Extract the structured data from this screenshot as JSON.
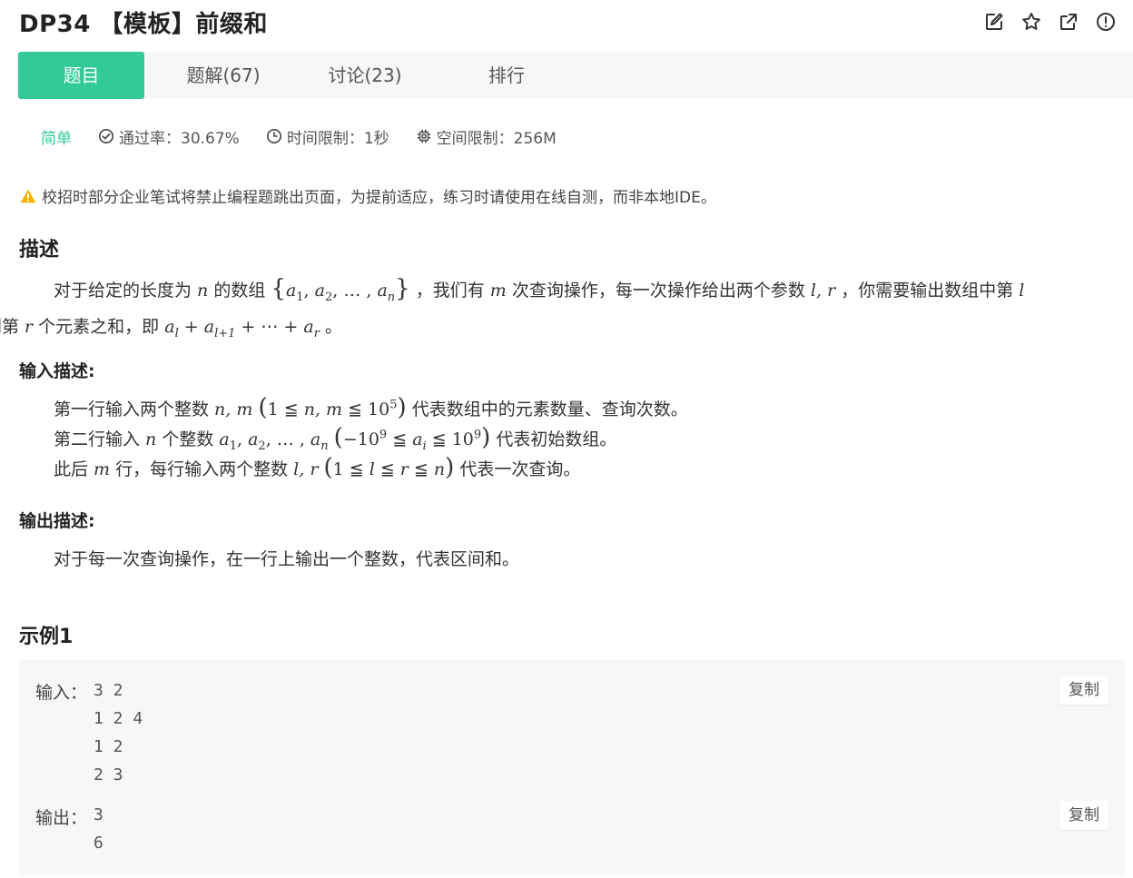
{
  "header": {
    "title": "DP34 【模板】前缀和"
  },
  "tabs": [
    {
      "label": "题目"
    },
    {
      "label": "题解(67)"
    },
    {
      "label": "讨论(23)"
    },
    {
      "label": "排行"
    }
  ],
  "meta": {
    "difficulty": "简单",
    "pass_rate": "通过率：30.67%",
    "time_limit": "时间限制：1秒",
    "memory_limit": "空间限制：256M"
  },
  "warning": "校招时部分企业笔试将禁止编程题跳出页面，为提前适应，练习时请使用在线自测，而非本地IDE。",
  "description": {
    "heading": "描述",
    "t1": "对于给定的长度为 ",
    "n": "n",
    "t2": " 的数组 ",
    "arr_a1": "a",
    "sub1": "1",
    "sub2": "2",
    "arr_an": "a",
    "subn": "n",
    "comma_dots": ", … , ",
    "t3": " ，我们有 ",
    "m": "m",
    "t4": " 次查询操作，每一次操作给出两个参数 ",
    "lr": "l, r",
    "t5": " ，你需要输出数组中第 ",
    "l": "l",
    "t6": "到第 ",
    "r": "r",
    "t7": " 个元素之和，即 ",
    "sum_al": "a",
    "sub_l": "l",
    "plus": " + ",
    "sum_al1": "a",
    "sub_l1": "l+1",
    "dots": " + ⋯ + ",
    "sum_ar": "a",
    "sub_r": "r",
    "t8": " 。"
  },
  "input": {
    "heading": "输入描述:",
    "l1_a": "第一行输入两个整数 ",
    "l1_vars": "n, m",
    "l1_cond1": "1 ≦ ",
    "l1_cond2": "n, m",
    "l1_cond3": " ≦ 10",
    "l1_exp": "5",
    "l1_b": " 代表数组中的元素数量、查询次数。",
    "l2_a": "第二行输入 ",
    "l2_n": "n",
    "l2_b": " 个整数 ",
    "l2_arr": "a",
    "l2_s1": "1",
    "l2_s2": "2",
    "l2_sn": "n",
    "l2_c1": "−10",
    "l2_e1": "9",
    "l2_c2": " ≦ ",
    "l2_ai": "a",
    "l2_si": "i",
    "l2_c3": " ≦ 10",
    "l2_e2": "9",
    "l2_d": " 代表初始数组。",
    "l3_a": "此后 ",
    "l3_m": "m",
    "l3_b": " 行，每行输入两个整数 ",
    "l3_lr": "l, r",
    "l3_c1": "1 ≦ ",
    "l3_c2": "l",
    "l3_c3": " ≦ ",
    "l3_c4": "r",
    "l3_c5": " ≦ ",
    "l3_c6": "n",
    "l3_d": " 代表一次查询。"
  },
  "output": {
    "heading": "输出描述:",
    "text": "对于每一次查询操作，在一行上输出一个整数，代表区间和。"
  },
  "example": {
    "heading": "示例1",
    "input_label": "输入：",
    "input_lines": [
      "3 2",
      "1 2 4",
      "1 2",
      "2 3"
    ],
    "output_label": "输出：",
    "output_lines": [
      "3",
      "6"
    ],
    "copy_label": "复制"
  },
  "colors": {
    "accent": "#32ca99",
    "warning": "#f5b400",
    "panel": "#f6f7f9"
  },
  "icons": [
    "edit-icon",
    "star-icon",
    "share-icon",
    "report-icon",
    "check-circle-icon",
    "clock-icon",
    "chip-icon",
    "warning-icon"
  ]
}
